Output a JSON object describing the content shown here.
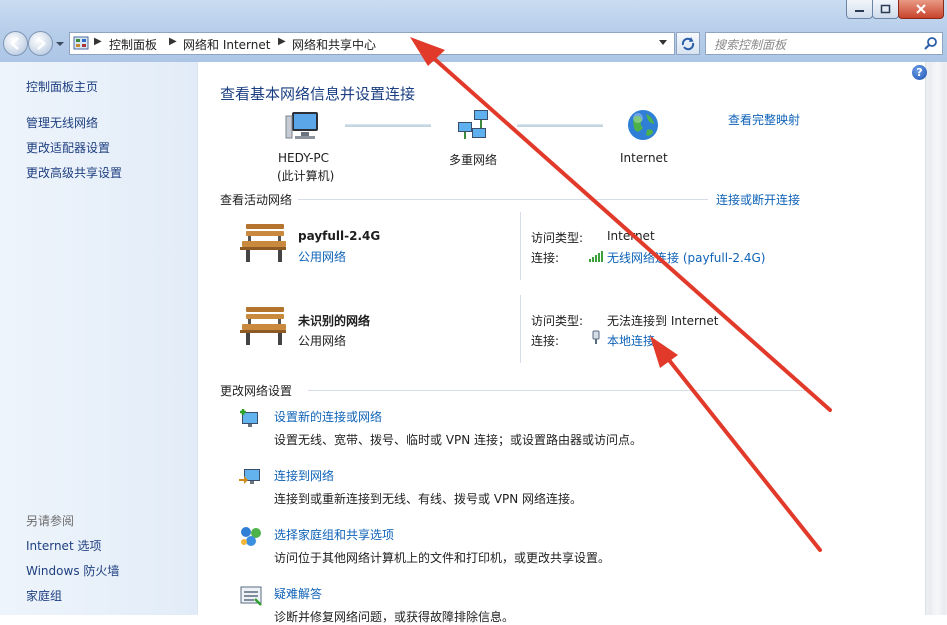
{
  "address": {
    "crumbs": [
      "控制面板",
      "网络和 Internet",
      "网络和共享中心"
    ]
  },
  "search": {
    "placeholder": "搜索控制面板"
  },
  "sidebar": {
    "home": "控制面板主页",
    "links": [
      "管理无线网络",
      "更改适配器设置",
      "更改高级共享设置"
    ],
    "see_also_header": "另请参阅",
    "see_also": [
      "Internet 选项",
      "Windows 防火墙",
      "家庭组"
    ]
  },
  "main": {
    "title": "查看基本网络信息并设置连接",
    "map_link": "查看完整映射",
    "map": {
      "pc_name": "HEDY-PC",
      "pc_sub": "(此计算机)",
      "multi": "多重网络",
      "internet": "Internet"
    },
    "active_header": "查看活动网络",
    "connect_link": "连接或断开连接",
    "networks": [
      {
        "name": "payfull-2.4G",
        "category": "公用网络",
        "access_label": "访问类型:",
        "access_value": "Internet",
        "conn_label": "连接:",
        "conn_value": "无线网络连接 (payfull-2.4G)"
      },
      {
        "name": "未识别的网络",
        "category": "公用网络",
        "access_label": "访问类型:",
        "access_value": "无法连接到 Internet",
        "conn_label": "连接:",
        "conn_value": "本地连接"
      }
    ],
    "change_header": "更改网络设置",
    "tasks": [
      {
        "title": "设置新的连接或网络",
        "desc": "设置无线、宽带、拨号、临时或 VPN 连接；或设置路由器或访问点。"
      },
      {
        "title": "连接到网络",
        "desc": "连接到或重新连接到无线、有线、拨号或 VPN 网络连接。"
      },
      {
        "title": "选择家庭组和共享选项",
        "desc": "访问位于其他网络计算机上的文件和打印机，或更改共享设置。"
      },
      {
        "title": "疑难解答",
        "desc": "诊断并修复网络问题，或获得故障排除信息。"
      }
    ]
  }
}
